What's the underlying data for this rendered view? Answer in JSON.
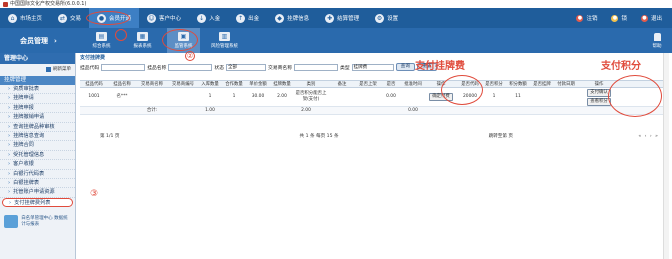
{
  "window": {
    "title": "中国国际文化产权交易所(6.0.0.1)"
  },
  "topnav": {
    "items": [
      {
        "icon": "home-icon",
        "label": "市场主页"
      },
      {
        "icon": "trade-icon",
        "label": "交易"
      },
      {
        "icon": "member-icon",
        "label": "会员开通"
      },
      {
        "icon": "user-icon",
        "label": "客户中心"
      },
      {
        "icon": "deposit-icon",
        "label": "入金"
      },
      {
        "icon": "withdraw-icon",
        "label": "出金"
      },
      {
        "icon": "listing-icon",
        "label": "挂牌信息"
      },
      {
        "icon": "settle-icon",
        "label": "结算管理"
      },
      {
        "icon": "settings-icon",
        "label": "设置"
      }
    ],
    "right": [
      {
        "icon": "logout-icon",
        "label": "注销"
      },
      {
        "icon": "lock-icon",
        "label": "锁"
      },
      {
        "icon": "exit-icon",
        "label": "退出"
      }
    ]
  },
  "module": {
    "title": "会员管理",
    "arrow": "›"
  },
  "subnav": [
    {
      "icon": "integrated-icon",
      "label": "综合系统"
    },
    {
      "icon": "report-icon",
      "label": "报表系统"
    },
    {
      "icon": "audit-icon",
      "label": "监管系统"
    },
    {
      "icon": "risk-icon",
      "label": "风险管理系统"
    }
  ],
  "user_corner": {
    "label": "帮助",
    "top_label": "查询"
  },
  "sidebar": {
    "header": "管理中心",
    "tools_label": "刷新菜单",
    "group": "挂牌管理",
    "items": [
      "资质审批表",
      "挂牌申请",
      "挂牌申报",
      "挂牌撤销申请",
      "查询挂牌品种审核",
      "挂牌信息查询",
      "挂牌合同",
      "受托管理信息",
      "客户收银",
      "白银行代码表",
      "白银挂牌表",
      "托管账户申请资源",
      "支付挂牌费列表"
    ],
    "footer": "白名单管理中心 数据统计与报表"
  },
  "main": {
    "breadcrumb": "支付挂牌费",
    "filter": {
      "label1": "挂品代码",
      "value1": "",
      "label2": "挂品名称",
      "value2": "",
      "label3": "状态",
      "value3": "全部",
      "label4": "交易商名称",
      "value4": "",
      "label5": "类型",
      "value5": "挂牌费",
      "query": "查询",
      "reset": "重置"
    },
    "annotations": {
      "fee": "支付挂牌费",
      "points": "支付积分",
      "n1": "①",
      "n2": "②",
      "n3": "③"
    },
    "table": {
      "headers": [
        "挂品代码",
        "挂品名称",
        "交易商名称",
        "交易商编号",
        "入库数量",
        "合作数量",
        "单价金额",
        "挂牌数量",
        "类别",
        "备注",
        "是否上架",
        "是否",
        "批准时间",
        "操作",
        "是否代码",
        "是否积分",
        "积分数额",
        "是否挂牌",
        "付款日期",
        "操作"
      ],
      "row": [
        "1001",
        "名***",
        "",
        "",
        "1",
        "1",
        "30.00",
        "2.00",
        "是否积分能否上架(支付)",
        "",
        "",
        "0.00",
        "",
        "确定付费",
        "20000",
        "1",
        "11",
        "",
        "",
        "支付确认"
      ],
      "row_op2": "查看积分",
      "sum": {
        "label": "合计:",
        "c1": "1.00",
        "c2": "2.00",
        "c3": "0.00"
      }
    },
    "pager": {
      "pages": "第 1/1 页",
      "records": "共 1 条 每页 15 条",
      "goto": "跳转至第  页",
      "nav": "« ‹ › »"
    }
  },
  "colors": {
    "nav": "#1f5d9b",
    "subbar": "#2a6aad",
    "accent": "#e04b3c"
  }
}
